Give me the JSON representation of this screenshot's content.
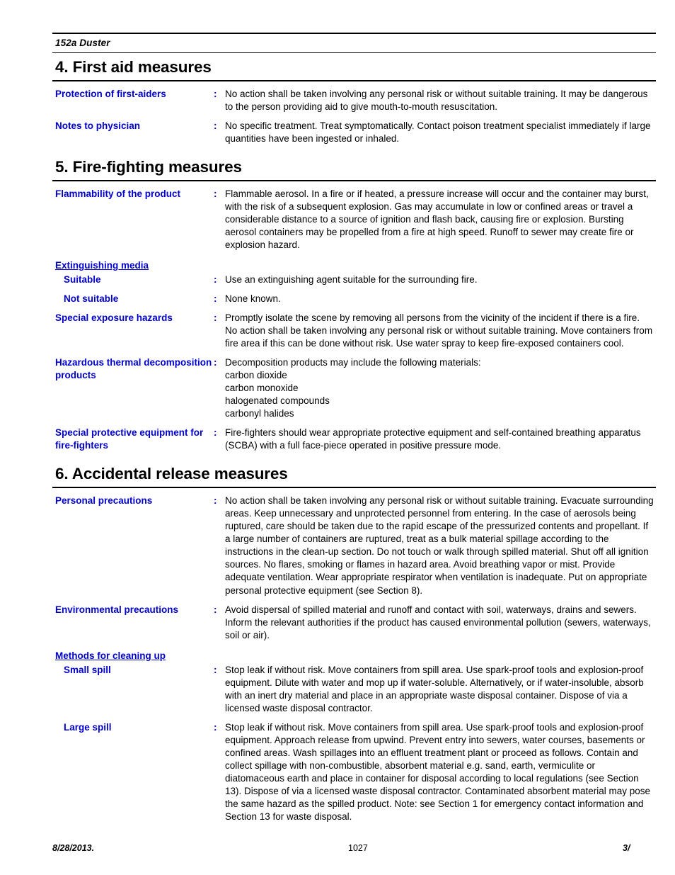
{
  "document": {
    "running_header": "152a Duster"
  },
  "sections": [
    {
      "id": "section-4",
      "title": "4. First aid measures",
      "rows": [
        {
          "label": "Protection of first-aiders",
          "colon": ":",
          "value": "No action shall be taken involving any personal risk or without suitable training.  It may be dangerous to the person providing aid to give mouth-to-mouth resuscitation."
        },
        {
          "label": "Notes to physician",
          "colon": ":",
          "value": "No specific treatment.  Treat symptomatically.  Contact poison treatment specialist immediately if large quantities have been ingested or inhaled."
        }
      ]
    },
    {
      "id": "section-5",
      "title": "5. Fire-fighting measures",
      "rows": [
        {
          "label": "Flammability of the product",
          "colon": ":",
          "value": "Flammable aerosol.  In a fire or if heated, a pressure increase will occur and the container may burst, with the risk of a subsequent explosion.  Gas may accumulate in low or confined areas or travel a considerable distance to a source of ignition and flash back, causing fire or explosion.  Bursting aerosol containers may be propelled from a fire at high speed.  Runoff to sewer may create fire or explosion hazard."
        },
        {
          "group_heading": "Extinguishing media"
        },
        {
          "label": "Suitable",
          "indent": true,
          "colon": ":",
          "value": "Use an extinguishing agent suitable for the surrounding fire."
        },
        {
          "label": "Not suitable",
          "indent": true,
          "colon": ":",
          "value": "None known."
        },
        {
          "label": "Special exposure hazards",
          "colon": ":",
          "value": "Promptly isolate the scene by removing all persons from the vicinity of the incident if there is a fire.  No action shall be taken involving any personal risk or without suitable training.  Move containers from fire area if this can be done without risk.  Use water spray to keep fire-exposed containers cool."
        },
        {
          "label": "Hazardous thermal decomposition products",
          "colon": ":",
          "value": "Decomposition products may include the following materials:",
          "value_lines": [
            "carbon dioxide",
            "carbon monoxide",
            "halogenated compounds",
            "carbonyl halides"
          ]
        },
        {
          "label": "Special protective equipment for fire-fighters",
          "colon": ":",
          "value": "Fire-fighters should wear appropriate protective equipment and self-contained breathing apparatus (SCBA) with a full face-piece operated in positive pressure mode."
        }
      ]
    },
    {
      "id": "section-6",
      "title": "6. Accidental release measures",
      "rows": [
        {
          "label": "Personal precautions",
          "colon": ":",
          "value": "No action shall be taken involving any personal risk or without suitable training.  Evacuate surrounding areas.  Keep unnecessary and unprotected personnel from entering.  In the case of aerosols being ruptured, care should be taken due to the rapid escape of the pressurized contents and propellant.  If a large number of containers are ruptured, treat as a bulk material spillage according to the instructions in the clean-up section.  Do not touch or walk through spilled material.  Shut off all ignition sources.  No flares, smoking or flames in hazard area.  Avoid breathing vapor or mist.  Provide adequate ventilation.  Wear appropriate respirator when ventilation is inadequate.  Put on appropriate personal protective equipment (see Section 8)."
        },
        {
          "label": "Environmental precautions",
          "colon": ":",
          "value": "Avoid dispersal of spilled material and runoff and contact with soil, waterways, drains and sewers.  Inform the relevant authorities if the product has caused environmental pollution (sewers, waterways, soil or air)."
        },
        {
          "group_heading": "Methods for cleaning up"
        },
        {
          "label": "Small spill",
          "indent": true,
          "colon": ":",
          "value": "Stop leak if without risk.  Move containers from spill area.  Use spark-proof tools and explosion-proof equipment.  Dilute with water and mop up if water-soluble.  Alternatively, or if water-insoluble, absorb with an inert dry material and place in an appropriate waste disposal container.  Dispose of via a licensed waste disposal contractor."
        },
        {
          "label": "Large spill",
          "indent": true,
          "colon": ":",
          "value": "Stop leak if without risk.  Move containers from spill area.  Use spark-proof tools and explosion-proof equipment.  Approach release from upwind.  Prevent entry into sewers, water courses, basements or confined areas.  Wash spillages into an effluent treatment plant or proceed as follows.  Contain and collect spillage with non-combustible, absorbent material e.g. sand, earth, vermiculite or diatomaceous earth and place in container for disposal according to local regulations (see Section 13).  Dispose of via a licensed waste disposal contractor.  Contaminated absorbent material may pose the same hazard as the spilled product.  Note: see Section 1 for emergency contact information and Section 13 for waste disposal."
        }
      ]
    }
  ],
  "footer": {
    "date": "8/28/2013.",
    "center": "1027",
    "page": "3/"
  },
  "colors": {
    "label_blue": "#0000CC",
    "body_black": "#000000",
    "rule_black": "#000000"
  }
}
